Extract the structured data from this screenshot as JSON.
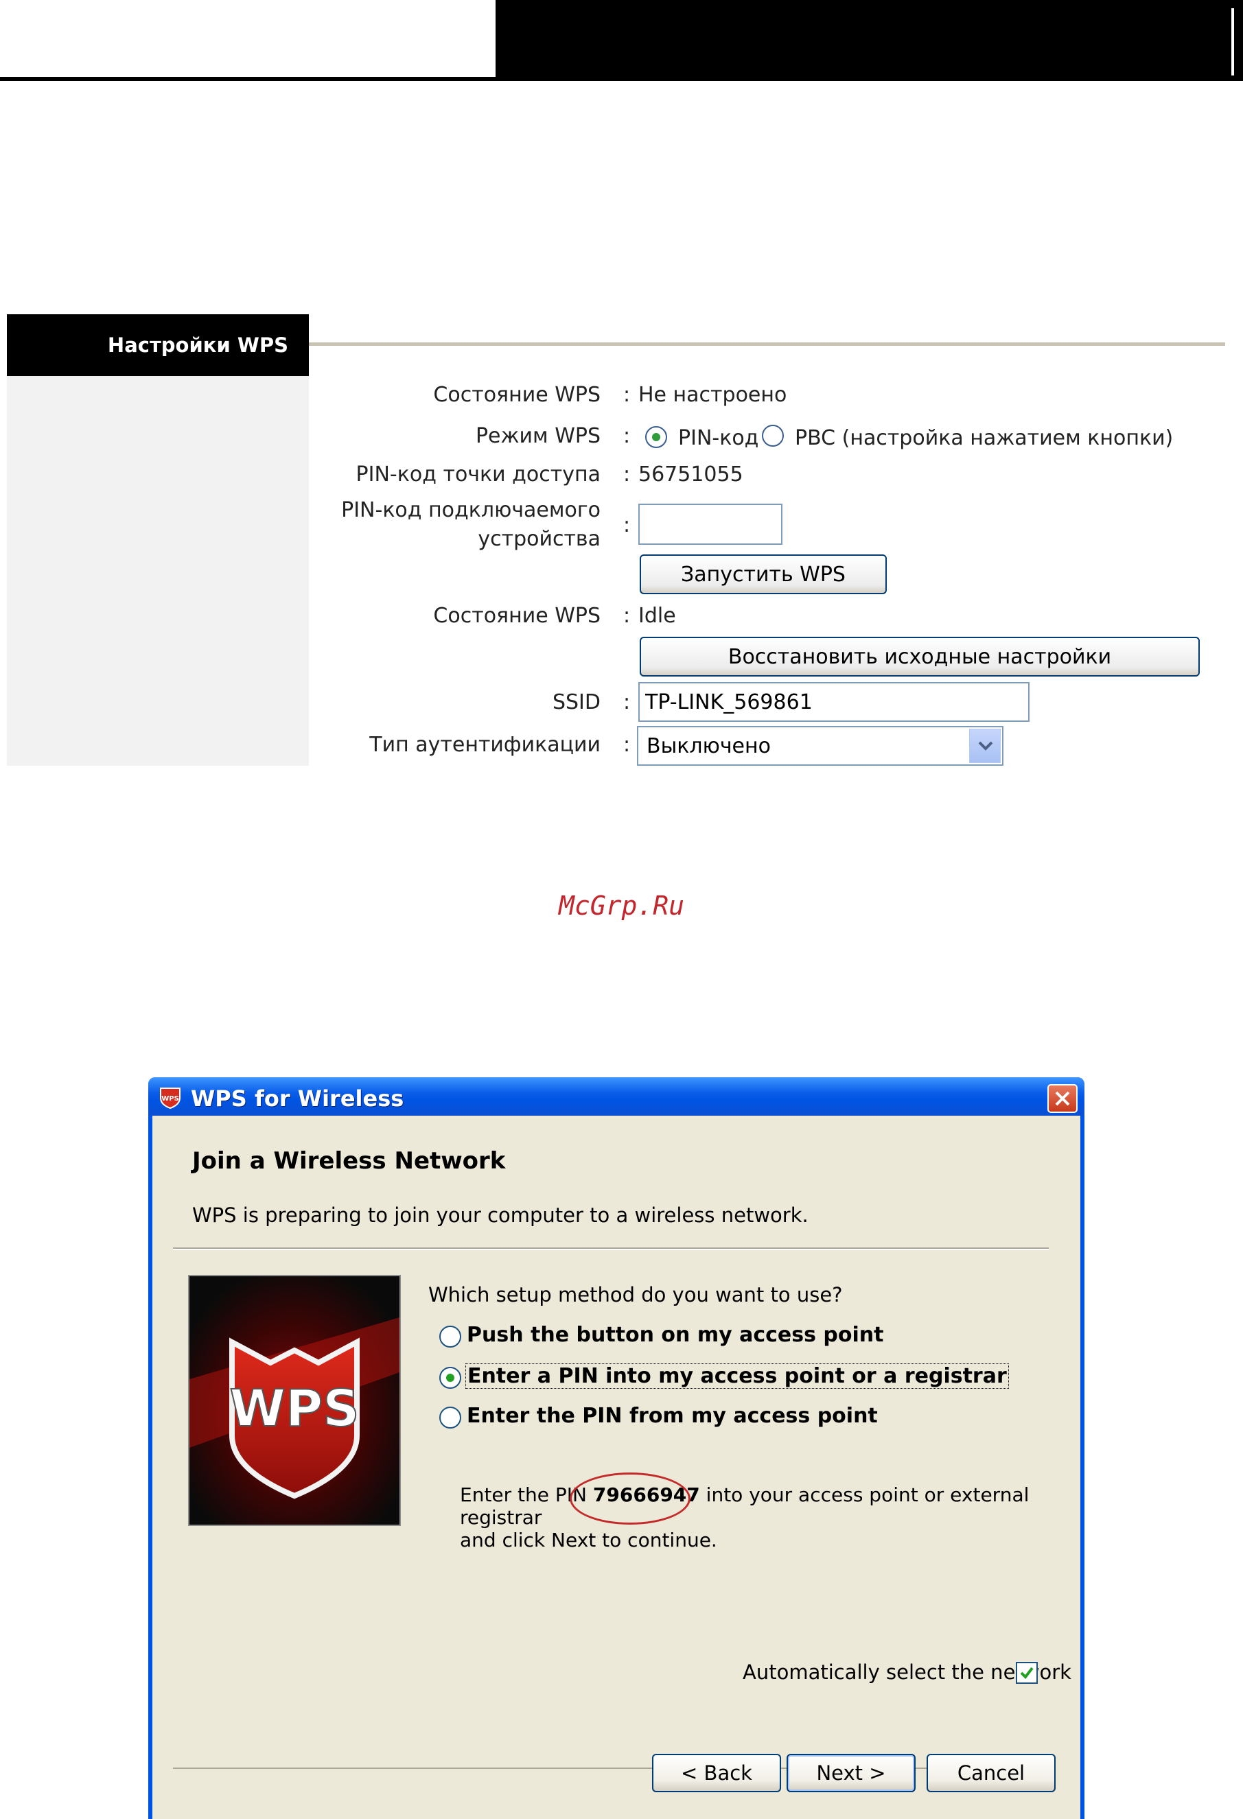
{
  "wps_settings": {
    "panel_title": "Настройки WPS",
    "rows": {
      "status_label": "Состояние WPS",
      "status_value": "Не настроено",
      "mode_label": "Режим WPS",
      "mode_option_pin": "PIN-код",
      "mode_option_pbc": "PBC (настройка нажатием кнопки)",
      "ap_pin_label": "PIN-код точки доступа",
      "ap_pin_value": "56751055",
      "device_pin_label_line1": "PIN-код подключаемого",
      "device_pin_label_line2": "устройства",
      "device_pin_value": "",
      "start_wps_button": "Запустить WPS",
      "status2_label": "Состояние WPS",
      "status2_value": "Idle",
      "restore_defaults_button": "Восстановить исходные настройки",
      "ssid_label": "SSID",
      "ssid_value": "TP-LINK_569861",
      "auth_type_label": "Тип аутентификации",
      "auth_type_value": "Выключено"
    },
    "colon": ":",
    "selected_mode": "pin"
  },
  "watermark": "McGrp.Ru",
  "dialog": {
    "window_title": "WPS for Wireless",
    "heading": "Join a Wireless Network",
    "subtitle": "WPS is preparing to join your computer to a wireless network.",
    "image_text": "WPS",
    "question": "Which setup method do you want to use?",
    "options": [
      {
        "label": "Push the button on my access point",
        "selected": false
      },
      {
        "label": "Enter a PIN into my access point or a registrar",
        "selected": true
      },
      {
        "label": "Enter the PIN from my access point",
        "selected": false
      }
    ],
    "pin_text_before": "Enter the PIN ",
    "pin": "79666947",
    "pin_text_after": " into your access point or external registrar",
    "pin_text_line2": "and click Next to continue.",
    "auto_select_label": "Automatically select the network",
    "auto_select_checked": true,
    "buttons": {
      "back": "< Back",
      "next": "Next >",
      "cancel": "Cancel"
    }
  },
  "colors": {
    "xp_title_blue": "#0054e3",
    "dialog_bg": "#ece9d8",
    "panel_side_gray": "#f2f2f2",
    "watermark_red": "#c2272d",
    "pin_ellipse_red": "#c42a2a"
  }
}
